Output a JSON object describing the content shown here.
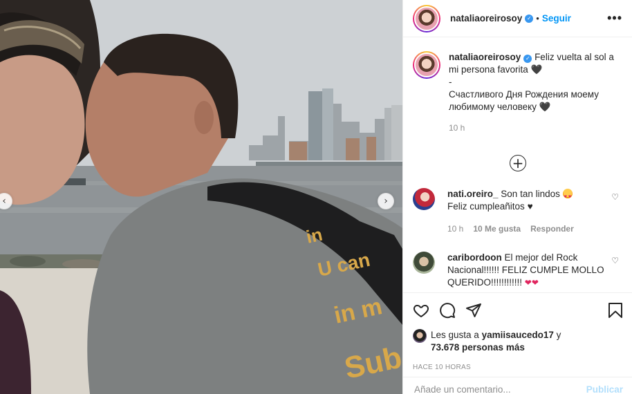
{
  "post": {
    "username": "nataliaoreirosoy",
    "follow_label": "Seguir",
    "dot": "•",
    "more_label": "•••"
  },
  "caption": {
    "username": "nataliaoreirosoy",
    "line1": "Feliz vuelta al sol a mi persona favorita",
    "heart1": "🖤",
    "dash": "-",
    "line2": "Счастливого Дня Рождения моему любимому человеку",
    "heart2": "🖤",
    "time": "10 h"
  },
  "comments": [
    {
      "username": "nati.oreiro_",
      "text": "Son tan lindos",
      "text2": "Feliz cumpleañitos",
      "heart": "♥",
      "time": "10 h",
      "likes": "10 Me gusta",
      "reply": "Responder"
    },
    {
      "username": "caribordoon",
      "text": "El mejor del Rock Nacional!!!!!! FELIZ CUMPLE MOLLO QUERIDO!!!!!!!!!!!!",
      "hearts": "❤❤"
    }
  ],
  "likes": {
    "prefix": "Les gusta a",
    "user": "yamiisaucedo17",
    "connector": "y",
    "count": "73.678 personas más"
  },
  "posted": "HACE 10 HORAS",
  "comment_box": {
    "placeholder": "Añade un comentario...",
    "publish": "Publicar"
  },
  "nav": {
    "prev": "‹",
    "next": "›"
  },
  "icons": {
    "like": "heart-outline",
    "comment": "speech-bubble",
    "share": "paper-plane",
    "save": "bookmark",
    "add": "plus-circle"
  },
  "colors": {
    "accent": "#0095f6",
    "verified": "#3897f0",
    "muted": "#8e8e8e",
    "publish_disabled": "#b2dffc"
  }
}
